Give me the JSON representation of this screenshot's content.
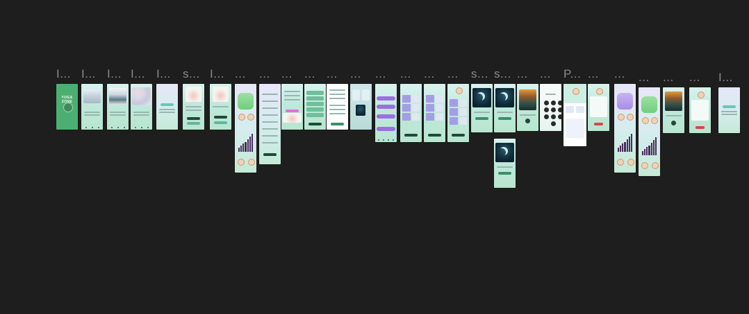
{
  "canvas": {
    "background": "#1e1e1e"
  },
  "frames": [
    {
      "label": "I...",
      "splash_title": "YOGA ZONE"
    },
    {
      "label": "I..."
    },
    {
      "label": "I..."
    },
    {
      "label": "I..."
    },
    {
      "label": "I..."
    },
    {
      "label": "s..."
    },
    {
      "label": "I..."
    },
    {
      "label": "..."
    },
    {
      "label": "..."
    },
    {
      "label": "..."
    },
    {
      "label": "..."
    },
    {
      "label": "..."
    },
    {
      "label": "..."
    },
    {
      "label": "..."
    },
    {
      "label": "..."
    },
    {
      "label": "..."
    },
    {
      "label": "..."
    },
    {
      "label": "s..."
    },
    {
      "label": "s..."
    },
    {
      "label": "..."
    },
    {
      "label": "..."
    },
    {
      "label": "P..."
    },
    {
      "label": "..."
    },
    {
      "label": "..."
    },
    {
      "label": "..."
    },
    {
      "label": "..."
    },
    {
      "label": "..."
    },
    {
      "label": "I..."
    }
  ]
}
